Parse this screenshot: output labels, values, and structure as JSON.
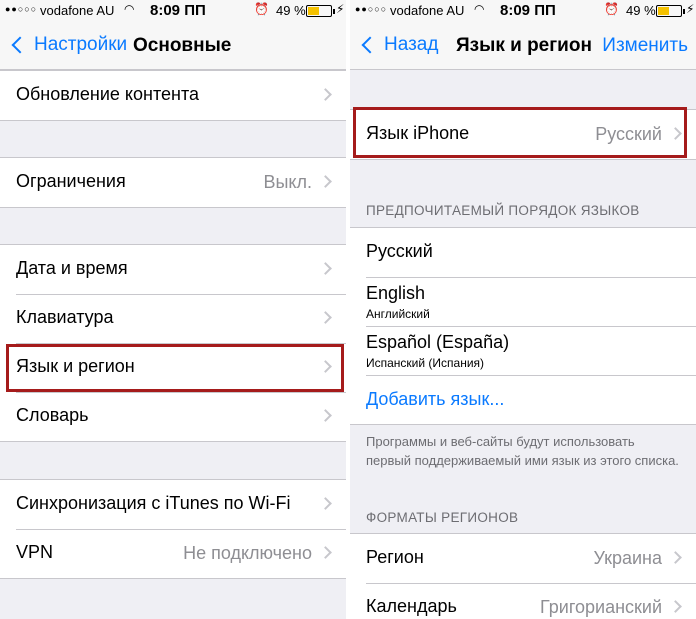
{
  "status": {
    "signal": "●●○○○",
    "carrier": "vodafone AU",
    "time": "8:09 ПП",
    "battery_pct": "49 %",
    "battery_level": 0.49,
    "battery_color": "#f5c200"
  },
  "left": {
    "back": "Настройки",
    "title": "Основные",
    "rows": {
      "update": "Обновление контента",
      "restrictions": "Ограничения",
      "restrictions_value": "Выкл.",
      "datetime": "Дата и время",
      "keyboard": "Клавиатура",
      "language_region": "Язык и регион",
      "dictionary": "Словарь",
      "itunes_sync": "Синхронизация с iTunes по Wi-Fi",
      "vpn": "VPN",
      "vpn_value": "Не подключено"
    }
  },
  "right": {
    "back": "Назад",
    "title": "Язык и регион",
    "action": "Изменить",
    "iphone_language_label": "Язык iPhone",
    "iphone_language_value": "Русский",
    "preferred_header": "ПРЕДПОЧИТАЕМЫЙ ПОРЯДОК ЯЗЫКОВ",
    "languages": [
      {
        "name": "Русский",
        "sub": ""
      },
      {
        "name": "English",
        "sub": "Английский"
      },
      {
        "name": "Español (España)",
        "sub": "Испанский (Испания)"
      }
    ],
    "add_language": "Добавить язык...",
    "footer": "Программы и веб-сайты будут использовать первый поддерживаемый ими язык из этого списка.",
    "formats_header": "ФОРМАТЫ РЕГИОНОВ",
    "region_label": "Регион",
    "region_value": "Украина",
    "calendar_label": "Календарь",
    "calendar_value": "Григорианский"
  },
  "colors": {
    "accent": "#0a7aff",
    "highlight": "#a51b1b"
  },
  "icons": {
    "wifi": "wifi-icon",
    "alarm": "alarm-icon",
    "bolt": "charging-bolt-icon"
  }
}
